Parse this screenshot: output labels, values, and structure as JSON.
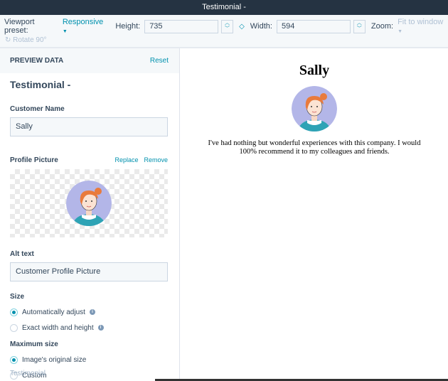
{
  "window": {
    "title": "Testimonial -"
  },
  "toolbar": {
    "viewport_label": "Viewport preset:",
    "viewport_value": "Responsive",
    "height_label": "Height:",
    "height_value": "735",
    "width_label": "Width:",
    "width_value": "594",
    "zoom_label": "Zoom:",
    "zoom_value": "Fit to window",
    "rotate_label": "Rotate 90°"
  },
  "panel": {
    "header": "PREVIEW DATA",
    "reset": "Reset",
    "title": "Testimonial -",
    "customer_name_label": "Customer Name",
    "customer_name_value": "Sally",
    "profile_picture_label": "Profile Picture",
    "replace": "Replace",
    "remove": "Remove",
    "alt_text_label": "Alt text",
    "alt_text_value": "Customer Profile Picture",
    "size_label": "Size",
    "size_options": [
      "Automatically adjust",
      "Exact width and height"
    ],
    "size_selected": 0,
    "max_size_label": "Maximum size",
    "max_size_options": [
      "Image's original size",
      "Custom"
    ],
    "max_size_selected": 0,
    "next_section": "Testimonial"
  },
  "preview": {
    "name": "Sally",
    "quote": "I've had nothing but wonderful experiences with this company. I would 100% recommend it to my colleagues and friends."
  },
  "colors": {
    "accent": "#0091ae",
    "titlebar": "#253342",
    "avatar_bg": "#b3b6e8"
  }
}
